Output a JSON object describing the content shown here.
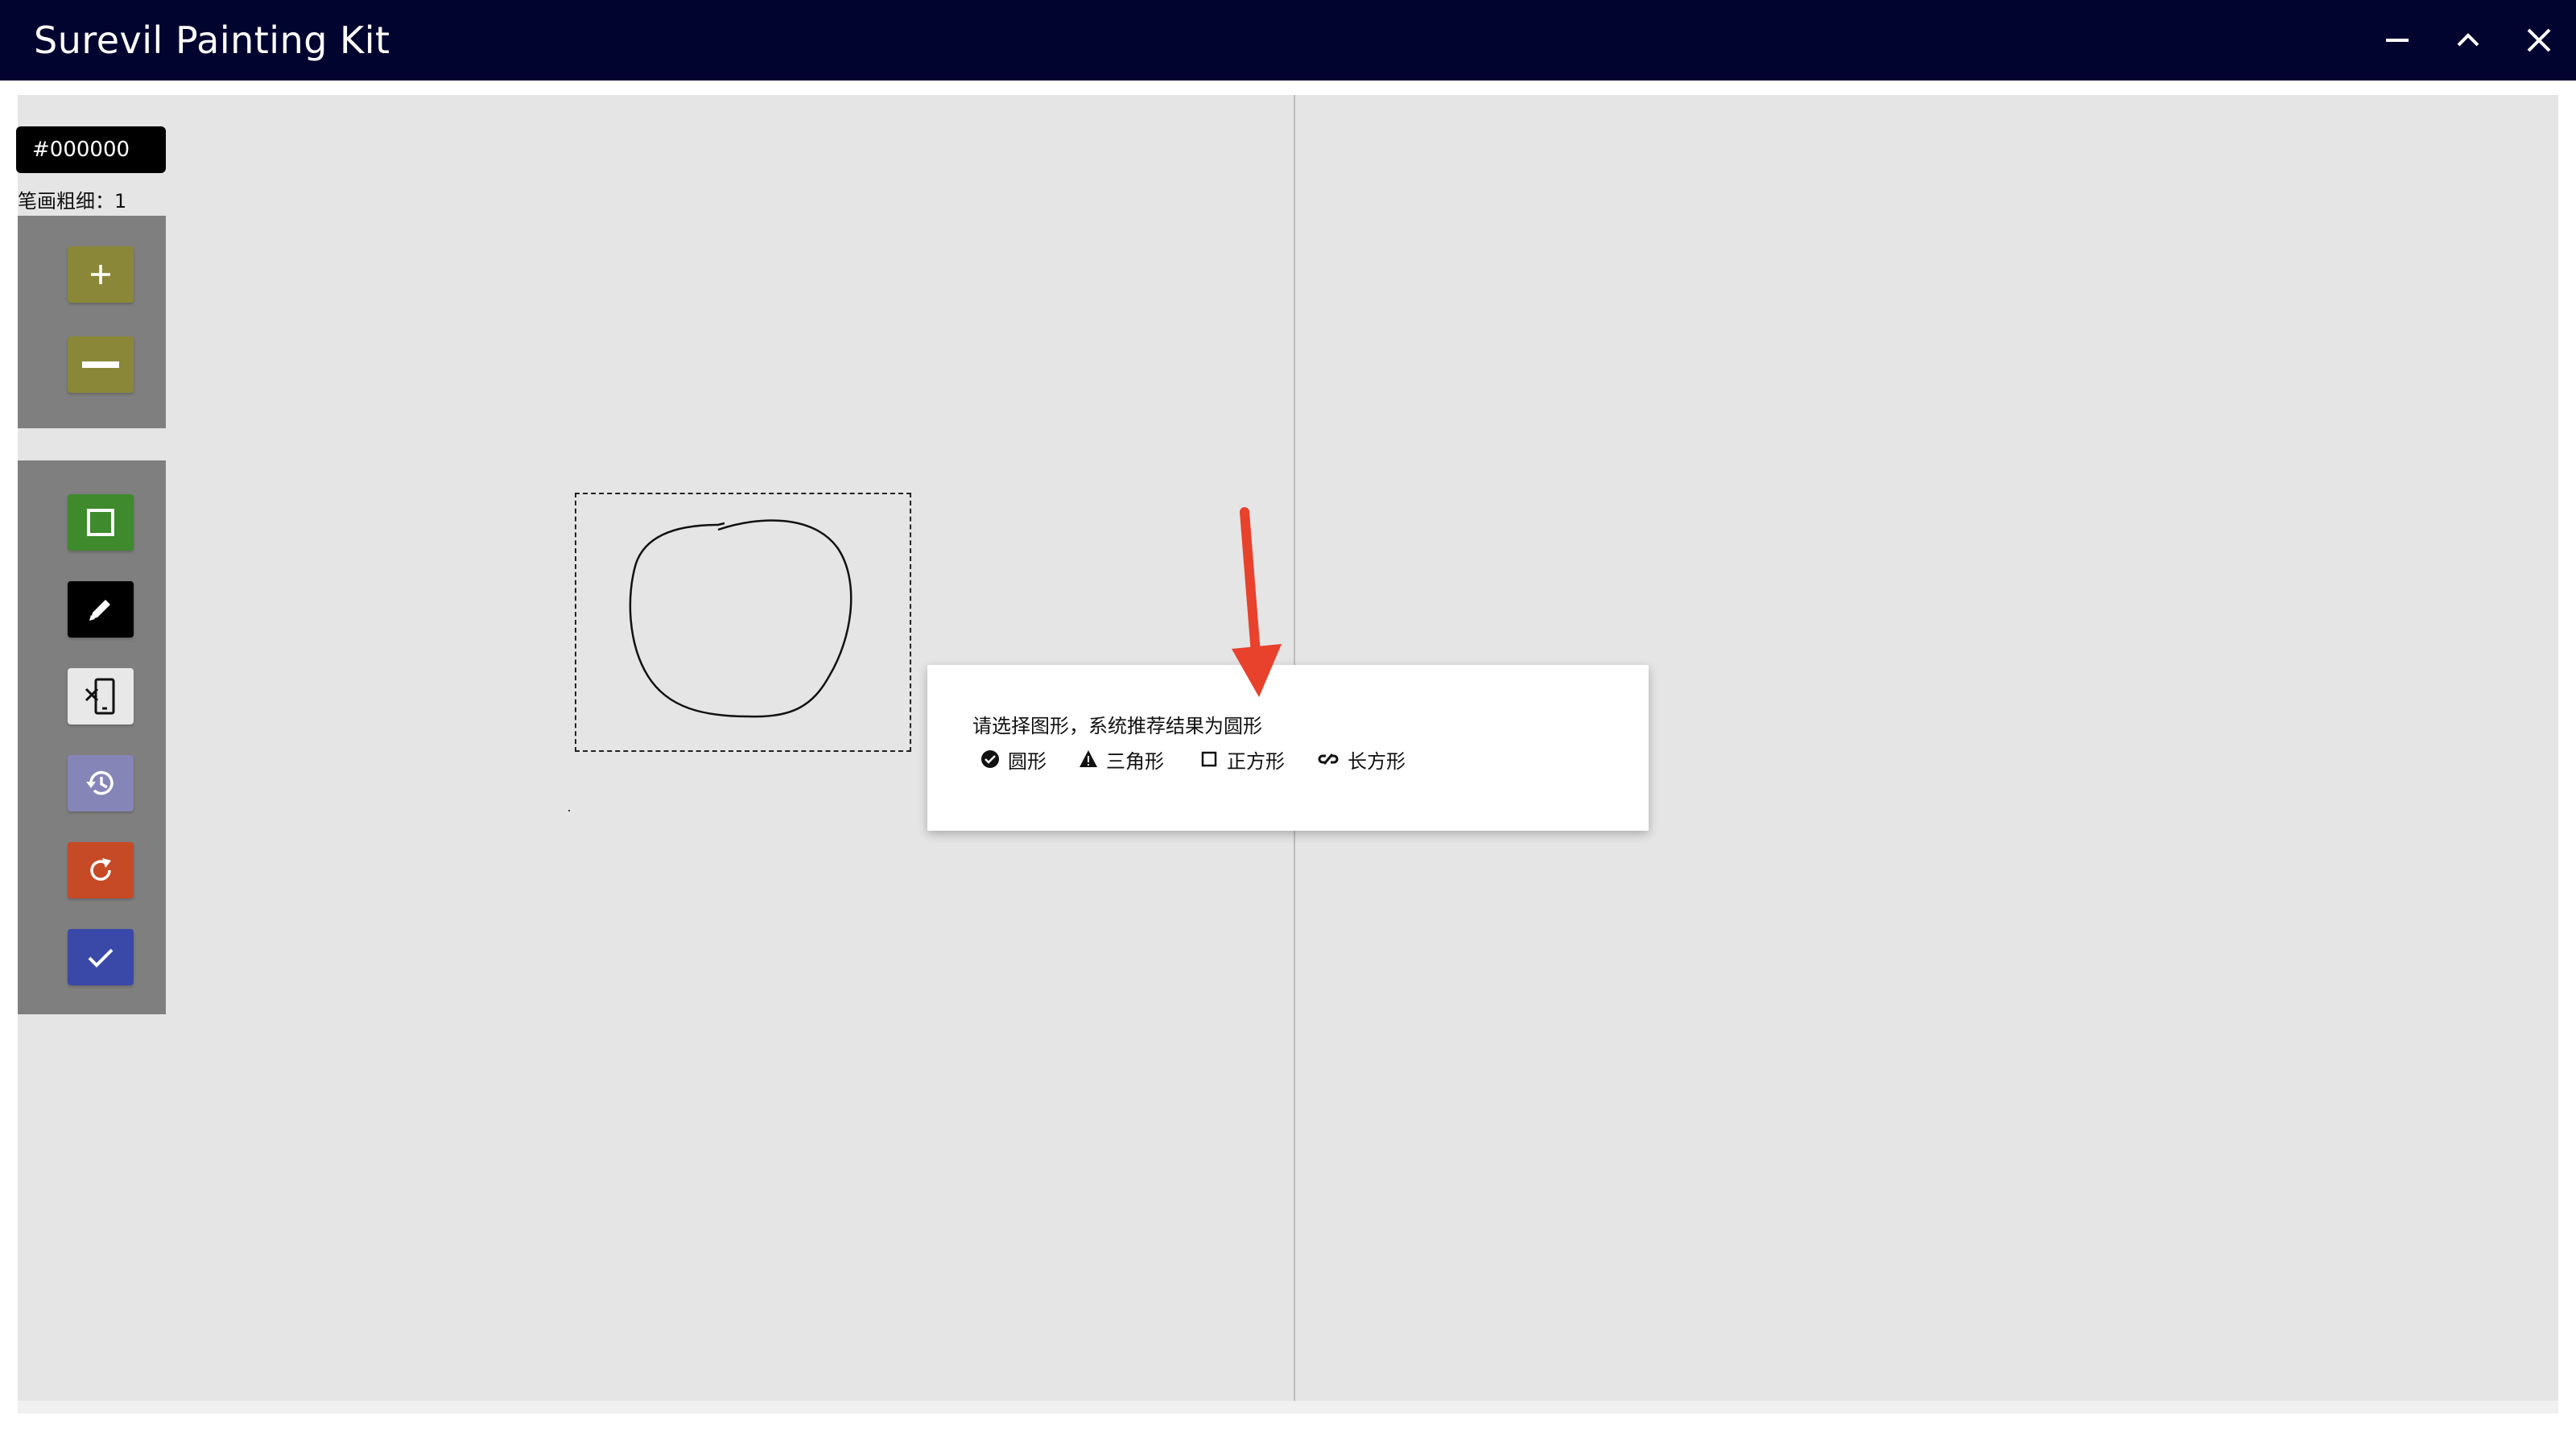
{
  "window": {
    "title": "Surevil Painting Kit",
    "controls": [
      "minimize",
      "maximize",
      "close"
    ],
    "titlebar_color": "#020430"
  },
  "toolbar": {
    "color_value": "#000000",
    "stroke_width_label": "笔画粗细：1",
    "stroke_buttons": [
      {
        "name": "increase-stroke",
        "icon": "plus-icon",
        "color": "#8a8838"
      },
      {
        "name": "decrease-stroke",
        "icon": "minus-icon",
        "color": "#8a8838"
      }
    ],
    "tools": [
      {
        "name": "shape-tool",
        "icon": "square-icon",
        "color": "#3e8a2c"
      },
      {
        "name": "pencil-tool",
        "icon": "pencil-icon",
        "color": "#000000"
      },
      {
        "name": "eraser-tool",
        "icon": "eraser-icon",
        "color": "#e8e8e8"
      },
      {
        "name": "history-tool",
        "icon": "history-icon",
        "color": "#8585b8"
      },
      {
        "name": "redo-tool",
        "icon": "refresh-icon",
        "color": "#c64a25"
      },
      {
        "name": "confirm-tool",
        "icon": "check-icon",
        "color": "#3a48a8"
      }
    ]
  },
  "dialog": {
    "message": "请选择图形，系统推荐结果为圆形",
    "options": [
      {
        "label": "圆形",
        "icon": "check-circle-icon",
        "selected": true
      },
      {
        "label": "三角形",
        "icon": "warning-triangle-icon",
        "selected": false
      },
      {
        "label": "正方形",
        "icon": "square-outline-icon",
        "selected": false
      },
      {
        "label": "长方形",
        "icon": "link-icon",
        "selected": false
      }
    ]
  },
  "annotation": {
    "arrow_color": "#e8412c"
  },
  "canvas": {
    "background": "#e5e5e5"
  }
}
